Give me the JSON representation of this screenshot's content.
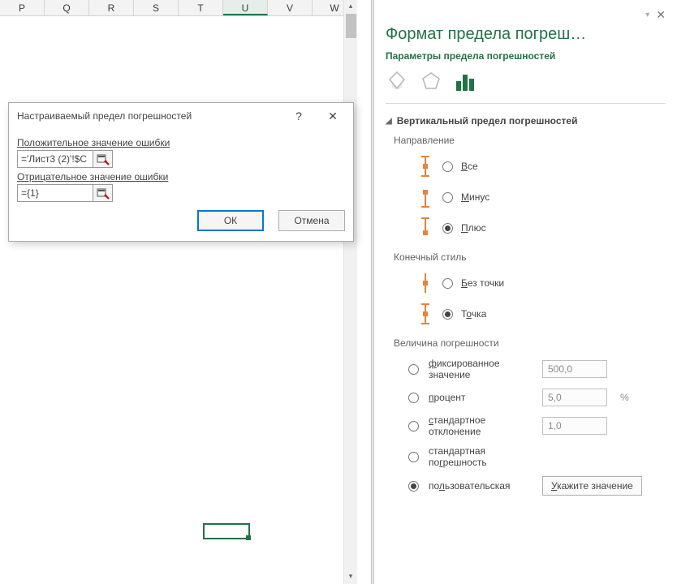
{
  "columns": [
    "P",
    "Q",
    "R",
    "S",
    "T",
    "U",
    "V",
    "W"
  ],
  "selected_column": "U",
  "dialog": {
    "title": "Настраиваемый предел погрешностей",
    "help": "?",
    "close": "✕",
    "pos_label": "Положительное значение ошибки",
    "pos_value": "='Лист3 (2)'!$C",
    "neg_label": "Отрицательное значение ошибки",
    "neg_value": "={1}",
    "ok": "ОК",
    "cancel": "Отмена"
  },
  "pane": {
    "menu": "▾",
    "close": "✕",
    "title": "Формат предела погреш…",
    "subtitle": "Параметры предела погрешностей",
    "section": "Вертикальный предел погрешностей",
    "direction_label": "Направление",
    "direction": {
      "all": "Все",
      "minus": "Минус",
      "plus": "Плюс",
      "selected": "plus"
    },
    "endstyle_label": "Конечный стиль",
    "endstyle": {
      "nocap": "Без точки",
      "cap": "Точка",
      "selected": "cap"
    },
    "amount_label": "Величина погрешности",
    "amount": {
      "fixed_label": "фиксированное значение",
      "fixed_value": "500,0",
      "percent_label": "процент",
      "percent_value": "5,0",
      "percent_suffix": "%",
      "stddev_label": "стандартное отклонение",
      "stddev_value": "1,0",
      "stderr_label": "стандартная погрешность",
      "custom_label": "пользовательская",
      "custom_button_u": "У",
      "custom_button_rest": "кажите значение",
      "selected": "custom"
    }
  }
}
